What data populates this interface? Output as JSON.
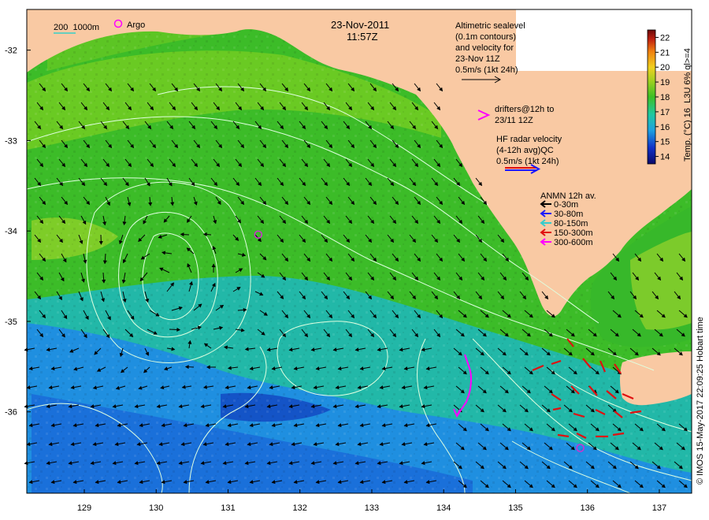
{
  "header": {
    "date": "23-Nov-2011",
    "time": "11:57Z"
  },
  "legend_top_left": {
    "isobaths": "200  1000m",
    "argo_label": "Argo"
  },
  "altimetry_note": {
    "lines": [
      "Altimetric sealevel",
      "(0.1m contours)",
      "and velocity for",
      "23-Nov 11Z",
      "0.5m/s (1kt 24h)"
    ]
  },
  "drifters_note": {
    "lines": [
      "drifters@12h to",
      "23/11 12Z"
    ]
  },
  "hf_radar_note": {
    "lines": [
      "HF radar velocity",
      "(4-12h avg)QC",
      "0.5m/s (1kt 24h)"
    ]
  },
  "anmn_legend": {
    "title": "ANMN 12h av.",
    "items": [
      {
        "label": "0-30m",
        "color": "#000000"
      },
      {
        "label": "30-80m",
        "color": "#1a1aff"
      },
      {
        "label": "80-150m",
        "color": "#33cccc"
      },
      {
        "label": "150-300m",
        "color": "#e01010"
      },
      {
        "label": "300-600m",
        "color": "#ff00ff"
      }
    ]
  },
  "colorbar": {
    "title": "Temp. (°C) 16_L3U 6% ql>=4",
    "ticks": [
      "14",
      "15",
      "16",
      "17",
      "18",
      "19",
      "20",
      "21",
      "22"
    ],
    "range": [
      13.5,
      22.5
    ]
  },
  "axes": {
    "x_ticks": [
      "129",
      "130",
      "131",
      "132",
      "133",
      "134",
      "135",
      "136",
      "137"
    ],
    "x_values": [
      129,
      130,
      131,
      132,
      133,
      134,
      135,
      136,
      137
    ],
    "y_ticks": [
      "-32",
      "-33",
      "-34",
      "-35",
      "-36"
    ],
    "y_values": [
      -32,
      -33,
      -34,
      -35,
      -36
    ],
    "lon_range": [
      128.2,
      137.45
    ],
    "lat_range": [
      -36.9,
      -31.55
    ]
  },
  "credit": "© IMOS 15-May-2017 22:09:25 Hobart time",
  "argo_floats": [
    {
      "lon": 131.42,
      "lat": -34.04
    },
    {
      "lon": 135.9,
      "lat": -36.4
    }
  ],
  "colors": {
    "land": "#f9c9a3",
    "sea_green": "#3fbf22",
    "sea_blue": "#1e8fe0",
    "contour": "#dfffe0",
    "drifter": "#ff00ff"
  }
}
